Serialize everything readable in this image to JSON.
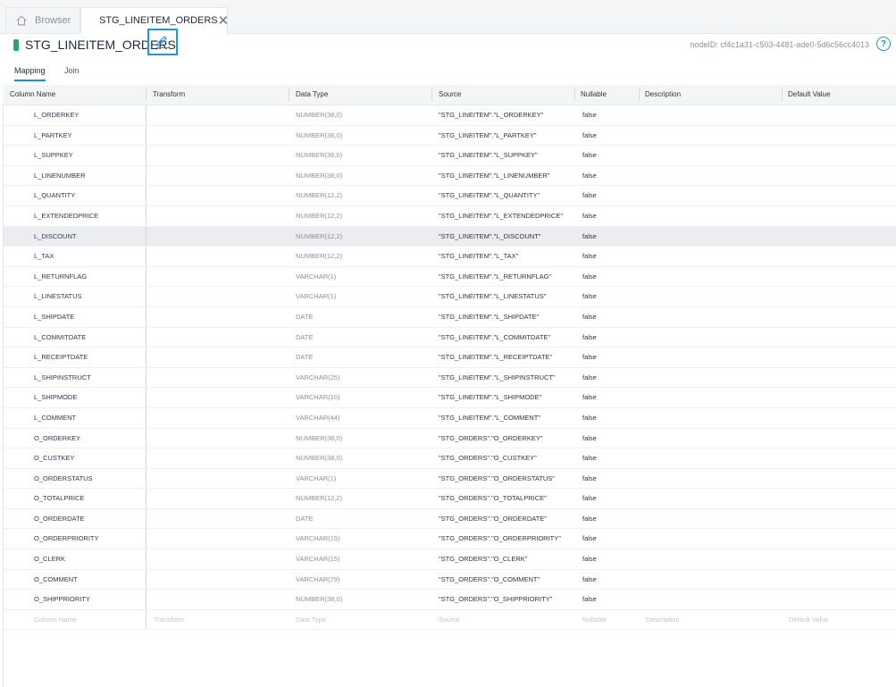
{
  "tabs": {
    "browser_label": "Browser",
    "active_label": "STG_LINEITEM_ORDERS"
  },
  "header": {
    "title": "STG_LINEITEM_ORDERS",
    "node_id": "nodeID: cf4c1a31-c503-4481-ade0-5d6c56cc4013"
  },
  "subtabs": {
    "mapping": "Mapping",
    "join": "Join"
  },
  "columns": {
    "name": "Column Name",
    "transform": "Transform",
    "data_type": "Data Type",
    "source": "Source",
    "nullable": "Nullable",
    "description": "Description",
    "default": "Default Value"
  },
  "rows": [
    {
      "name": "L_ORDERKEY",
      "type": "NUMBER(38,0)",
      "source": "\"STG_LINEITEM\".\"L_ORDERKEY\"",
      "nullable": "false"
    },
    {
      "name": "L_PARTKEY",
      "type": "NUMBER(38,0)",
      "source": "\"STG_LINEITEM\".\"L_PARTKEY\"",
      "nullable": "false"
    },
    {
      "name": "L_SUPPKEY",
      "type": "NUMBER(38,0)",
      "source": "\"STG_LINEITEM\".\"L_SUPPKEY\"",
      "nullable": "false"
    },
    {
      "name": "L_LINENUMBER",
      "type": "NUMBER(38,0)",
      "source": "\"STG_LINEITEM\".\"L_LINENUMBER\"",
      "nullable": "false"
    },
    {
      "name": "L_QUANTITY",
      "type": "NUMBER(12,2)",
      "source": "\"STG_LINEITEM\".\"L_QUANTITY\"",
      "nullable": "false"
    },
    {
      "name": "L_EXTENDEDPRICE",
      "type": "NUMBER(12,2)",
      "source": "\"STG_LINEITEM\".\"L_EXTENDEDPRICE\"",
      "nullable": "false"
    },
    {
      "name": "L_DISCOUNT",
      "type": "NUMBER(12,2)",
      "source": "\"STG_LINEITEM\".\"L_DISCOUNT\"",
      "nullable": "false"
    },
    {
      "name": "L_TAX",
      "type": "NUMBER(12,2)",
      "source": "\"STG_LINEITEM\".\"L_TAX\"",
      "nullable": "false"
    },
    {
      "name": "L_RETURNFLAG",
      "type": "VARCHAR(1)",
      "source": "\"STG_LINEITEM\".\"L_RETURNFLAG\"",
      "nullable": "false"
    },
    {
      "name": "L_LINESTATUS",
      "type": "VARCHAR(1)",
      "source": "\"STG_LINEITEM\".\"L_LINESTATUS\"",
      "nullable": "false"
    },
    {
      "name": "L_SHIPDATE",
      "type": "DATE",
      "source": "\"STG_LINEITEM\".\"L_SHIPDATE\"",
      "nullable": "false"
    },
    {
      "name": "L_COMMITDATE",
      "type": "DATE",
      "source": "\"STG_LINEITEM\".\"L_COMMITDATE\"",
      "nullable": "false"
    },
    {
      "name": "L_RECEIPTDATE",
      "type": "DATE",
      "source": "\"STG_LINEITEM\".\"L_RECEIPTDATE\"",
      "nullable": "false"
    },
    {
      "name": "L_SHIPINSTRUCT",
      "type": "VARCHAR(25)",
      "source": "\"STG_LINEITEM\".\"L_SHIPINSTRUCT\"",
      "nullable": "false"
    },
    {
      "name": "L_SHIPMODE",
      "type": "VARCHAR(10)",
      "source": "\"STG_LINEITEM\".\"L_SHIPMODE\"",
      "nullable": "false"
    },
    {
      "name": "L_COMMENT",
      "type": "VARCHAR(44)",
      "source": "\"STG_LINEITEM\".\"L_COMMENT\"",
      "nullable": "false"
    },
    {
      "name": "O_ORDERKEY",
      "type": "NUMBER(38,0)",
      "source": "\"STG_ORDERS\".\"O_ORDERKEY\"",
      "nullable": "false"
    },
    {
      "name": "O_CUSTKEY",
      "type": "NUMBER(38,0)",
      "source": "\"STG_ORDERS\".\"O_CUSTKEY\"",
      "nullable": "false"
    },
    {
      "name": "O_ORDERSTATUS",
      "type": "VARCHAR(1)",
      "source": "\"STG_ORDERS\".\"O_ORDERSTATUS\"",
      "nullable": "false"
    },
    {
      "name": "O_TOTALPRICE",
      "type": "NUMBER(12,2)",
      "source": "\"STG_ORDERS\".\"O_TOTALPRICE\"",
      "nullable": "false"
    },
    {
      "name": "O_ORDERDATE",
      "type": "DATE",
      "source": "\"STG_ORDERS\".\"O_ORDERDATE\"",
      "nullable": "false"
    },
    {
      "name": "O_ORDERPRIORITY",
      "type": "VARCHAR(15)",
      "source": "\"STG_ORDERS\".\"O_ORDERPRIORITY\"",
      "nullable": "false"
    },
    {
      "name": "O_CLERK",
      "type": "VARCHAR(15)",
      "source": "\"STG_ORDERS\".\"O_CLERK\"",
      "nullable": "false"
    },
    {
      "name": "O_COMMENT",
      "type": "VARCHAR(79)",
      "source": "\"STG_ORDERS\".\"O_COMMENT\"",
      "nullable": "false"
    },
    {
      "name": "O_SHIPPRIORITY",
      "type": "NUMBER(38,0)",
      "source": "\"STG_ORDERS\".\"O_SHIPPRIORITY\"",
      "nullable": "false"
    }
  ],
  "highlighted_row": "L_DISCOUNT",
  "placeholder_row": {
    "name": "Column Name",
    "transform": "Transform",
    "type": "Data Type",
    "source": "Source",
    "nullable": "Nullable",
    "description": "Description",
    "default": "Default Value"
  },
  "colors": {
    "accent": "#1a8fe0",
    "node_marker": "#2ea66b",
    "edit_highlight": "#1a9ae0"
  }
}
